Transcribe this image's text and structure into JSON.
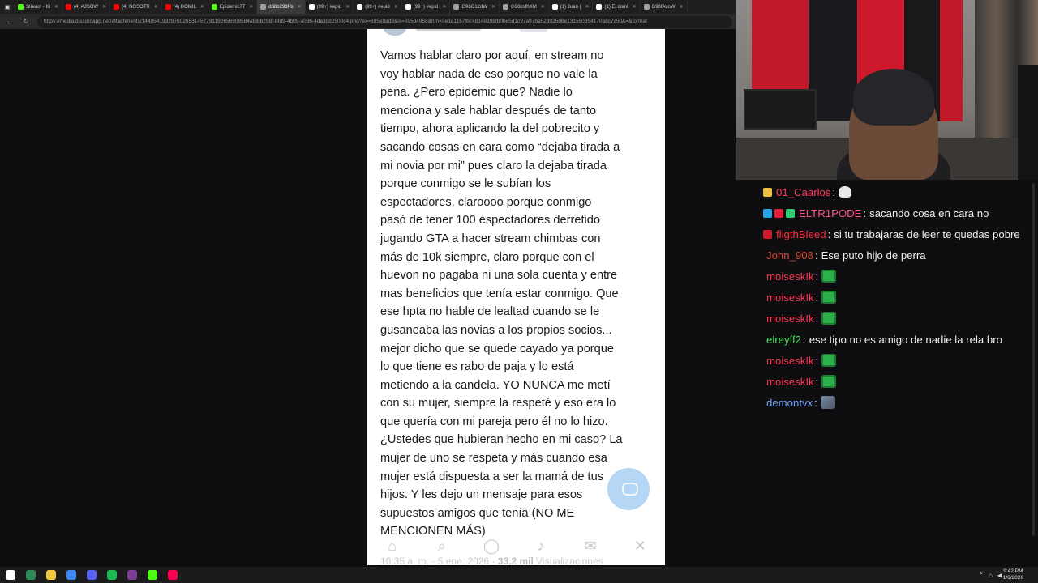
{
  "browser": {
    "tabs": [
      {
        "label": "Stream - Ki",
        "color": "#53fc18"
      },
      {
        "label": "(4) AJSOW",
        "color": "#ff0000"
      },
      {
        "label": "(4) NOSOTR",
        "color": "#ff0000"
      },
      {
        "label": "(4) DOMIL",
        "color": "#ff0000"
      },
      {
        "label": "Epidemic77",
        "color": "#53fc18"
      },
      {
        "label": "d88b298f-b",
        "color": "#9aa0a6",
        "active": true
      },
      {
        "label": "(99+) #epid",
        "color": "#ffffff"
      },
      {
        "label": "(99+) #epid",
        "color": "#ffffff"
      },
      {
        "label": "(99+) #epid",
        "color": "#ffffff"
      },
      {
        "label": "G96O12dW",
        "color": "#9aa0a6"
      },
      {
        "label": "G96bsfhXM",
        "color": "#9aa0a6"
      },
      {
        "label": "(1) Juan (",
        "color": "#ffffff"
      },
      {
        "label": "(1) El domi",
        "color": "#ffffff"
      },
      {
        "label": "G96fAcoW",
        "color": "#9aa0a6"
      }
    ],
    "url": "https://media.discordapp.net/attachments/1440541932976026531457791192656908584/d88b298f-bfd9-4b09-a096-4da3dd2500c4.png?ex=695e9ad8&is=695d4958&hm=3e3a1167fbc48148398fb0be5d1c97a97ba52d025d6e131550354170a8c7c50&=&format"
  },
  "post": {
    "text": "Vamos hablar claro por aquí, en stream no\nvoy hablar nada de eso porque no vale la\npena. ¿Pero epidemic que? Nadie lo\nmenciona y sale hablar después de tanto\ntiempo, ahora aplicando la del pobrecito y\nsacando cosas en cara como “dejaba tirada a\nmi novia por mi” pues claro la dejaba tirada\nporque conmigo se le subían los\nespectadores, claroooo porque conmigo\npasó de tener 100 espectadores derretido\njugando GTA a hacer stream chimbas con\nmás de 10k siempre, claro porque con el\nhuevon no pagaba ni una sola cuenta y entre\nmas beneficios que tenía estar conmigo. Que\nese hpta no hable de lealtad cuando se le\ngusaneaba las novias a los propios socios...\nmejor dicho que se quede cayado ya porque\nlo que tiene es rabo de paja y lo está\nmetiendo a la candela. YO NUNCA me metí\ncon su mujer, siempre la respeté y eso era lo\nque quería con mi pareja pero él no lo hizo.\n¿Ustedes que hubieran hecho en mi caso? La\nmujer de uno se respeta y más cuando esa\nmujer está dispuesta a ser la mamá de tus\nhijos. Y les dejo un mensaje para esos\nsupuestos amigos que tenía (NO ME\nMENCIONEN MÁS)",
    "meta_time": "10:35 a. m. · 5 ene. 2026 ·",
    "meta_views": "33,2 mil",
    "meta_views_label": "Visualizaciones"
  },
  "chat": {
    "messages": [
      {
        "user": "01_Caarlos",
        "color": "#ff3b5c",
        "badges": [
          "#f0c040"
        ],
        "text": "",
        "emote": "ghost"
      },
      {
        "user": "ELTR1PODE",
        "color": "#ff4f8b",
        "badges": [
          "#29a0e8",
          "#e0203a",
          "#2ecc71"
        ],
        "text": "sacando cosa en cara no",
        "emote": ""
      },
      {
        "user": "fligthBleed",
        "color": "#ff2a3d",
        "badges": [
          "#cc1b2b"
        ],
        "text": "si tu trabajaras de leer te quedas pobre",
        "emote": ""
      },
      {
        "user": "John_908",
        "color": "#d84a33",
        "badges": [],
        "text": "Ese puto hijo de perra",
        "emote": ""
      },
      {
        "user": "moiseskIk",
        "color": "#ff2f4f",
        "badges": [],
        "text": "",
        "emote": "green"
      },
      {
        "user": "moiseskIk",
        "color": "#ff2f4f",
        "badges": [],
        "text": "",
        "emote": "green"
      },
      {
        "user": "moiseskIk",
        "color": "#ff2f4f",
        "badges": [],
        "text": "",
        "emote": "green"
      },
      {
        "user": "elreyff2",
        "color": "#4fde5c",
        "badges": [],
        "text": "ese tipo no es amigo de nadie la rela bro",
        "emote": ""
      },
      {
        "user": "moiseskIk",
        "color": "#ff2f4f",
        "badges": [],
        "text": "",
        "emote": "green"
      },
      {
        "user": "moiseskIk",
        "color": "#ff2f4f",
        "badges": [],
        "text": "",
        "emote": "green"
      },
      {
        "user": "demontvx",
        "color": "#6fa0ff",
        "badges": [],
        "text": "",
        "emote": "avatar"
      }
    ]
  },
  "taskbar": {
    "time": "9:42 PM",
    "date": "1/6/2026",
    "apps": [
      {
        "name": "start",
        "color": "#ffffff"
      },
      {
        "name": "terminal",
        "color": "#2e8b57"
      },
      {
        "name": "files",
        "color": "#f2c744"
      },
      {
        "name": "chrome",
        "color": "#4285f4"
      },
      {
        "name": "discord",
        "color": "#5865f2"
      },
      {
        "name": "spotify",
        "color": "#1db954"
      },
      {
        "name": "obs",
        "color": "#7d3c98"
      },
      {
        "name": "kick",
        "color": "#53fc18"
      },
      {
        "name": "tiktok",
        "color": "#ff0050"
      }
    ]
  }
}
